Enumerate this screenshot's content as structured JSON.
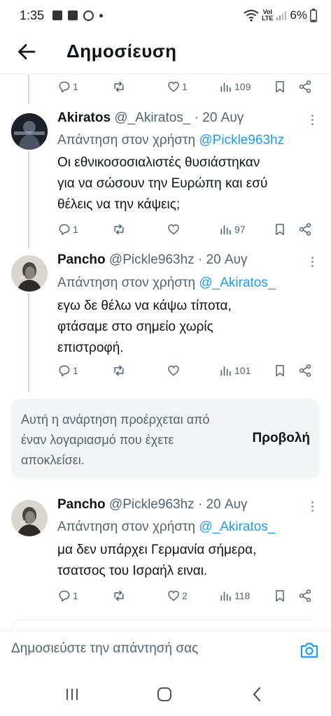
{
  "status_bar": {
    "time": "1:35",
    "network_label_top": "VoƖ",
    "network_label_bottom": "LTE",
    "battery": "6%"
  },
  "header": {
    "title": "Δημοσίευση"
  },
  "top_actions": {
    "replies": "1",
    "reposts": "",
    "likes": "1",
    "views": "109"
  },
  "tweets": [
    {
      "name": "Akiratos",
      "handle": "@_Akiratos_",
      "date": "· 20 Αυγ",
      "reply_prefix": "Απάντηση στον χρήστη",
      "reply_handle": "@Pickle963hz",
      "text_lines": [
        "Οι εθνικοσοσιαλιστές θυσιάστηκαν",
        "για να σώσουν την Ευρώπη και εσύ",
        "θέλεις να την κάψεις;"
      ],
      "replies": "1",
      "reposts": "",
      "likes": "",
      "views": "97"
    },
    {
      "name": "Pancho",
      "handle": "@Pickle963hz",
      "date": "· 20 Αυγ",
      "reply_prefix": "Απάντηση στον χρήστη",
      "reply_handle": "@_Akiratos_",
      "text_lines": [
        "εγω δε θέλω να κάψω τίποτα,",
        "φτάσαμε στο σημείο χωρίς",
        "επιστροφή."
      ],
      "replies": "1",
      "reposts": "",
      "likes": "",
      "views": "101"
    },
    {
      "name": "Pancho",
      "handle": "@Pickle963hz",
      "date": "· 20 Αυγ",
      "reply_prefix": "Απάντηση στον χρήστη",
      "reply_handle": "@_Akiratos_",
      "text_lines": [
        "μα δεν υπάρχει Γερμανία σήμερα,",
        "τσατσος του Ισραήλ ειναι."
      ],
      "replies": "1",
      "reposts": "",
      "likes": "2",
      "views": "118"
    }
  ],
  "blocked_notice": {
    "text": "Αυτή η ανάρτηση προέρχεται από έναν λογαριασμό που έχετε αποκλείσει.",
    "view_label": "Προβολή"
  },
  "compose": {
    "placeholder": "Δημοσιεύστε την απάντησή σας"
  },
  "colors": {
    "accent": "#1d9bf0",
    "secondary_text": "#536471",
    "thread_line": "#cfd9de"
  }
}
